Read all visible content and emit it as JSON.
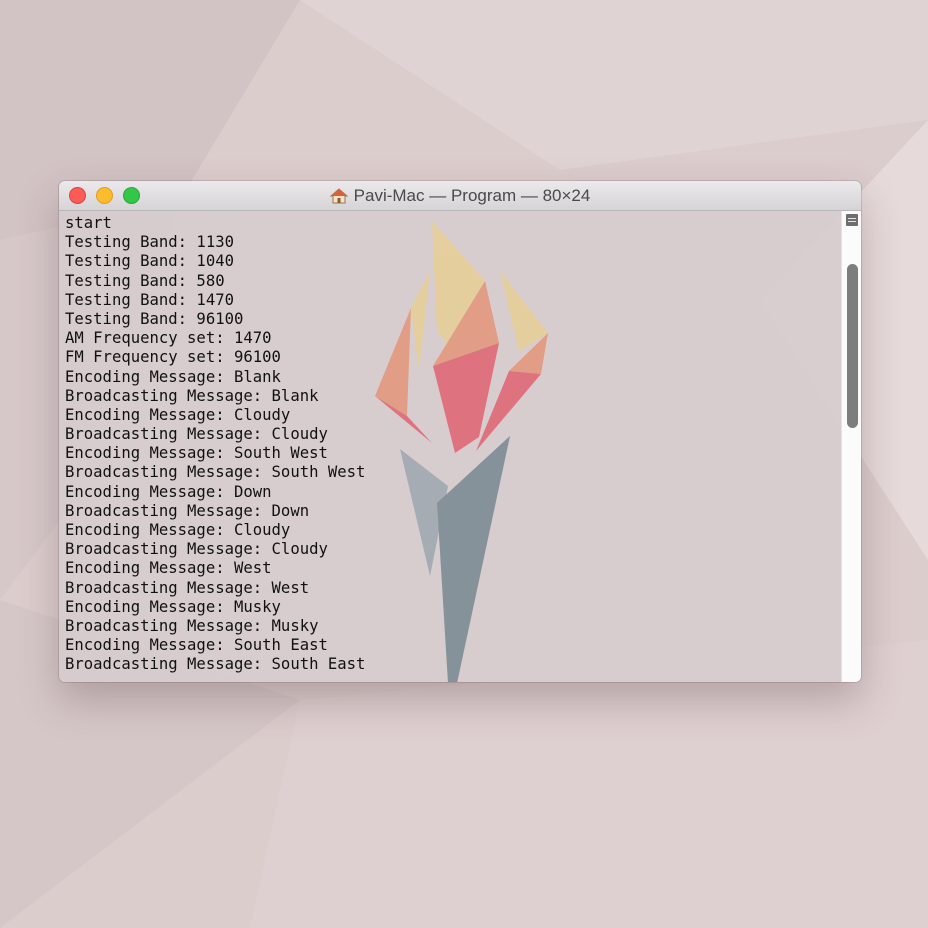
{
  "window": {
    "title": "Pavi-Mac — Program — 80×24",
    "title_icon": "home-icon"
  },
  "traffic_lights": {
    "close": "close-button",
    "minimize": "minimize-button",
    "maximize": "maximize-button"
  },
  "terminal": {
    "lines": [
      "start",
      "Testing Band: 1130",
      "Testing Band: 1040",
      "Testing Band: 580",
      "Testing Band: 1470",
      "Testing Band: 96100",
      "AM Frequency set: 1470",
      "FM Frequency set: 96100",
      "Encoding Message: Blank",
      "Broadcasting Message: Blank",
      "Encoding Message: Cloudy",
      "Broadcasting Message: Cloudy",
      "Encoding Message: South West",
      "Broadcasting Message: South West",
      "Encoding Message: Down",
      "Broadcasting Message: Down",
      "Encoding Message: Cloudy",
      "Broadcasting Message: Cloudy",
      "Encoding Message: West",
      "Broadcasting Message: West",
      "Encoding Message: Musky",
      "Broadcasting Message: Musky",
      "Encoding Message: South East",
      "Broadcasting Message: South East"
    ]
  },
  "colors": {
    "close": "#fc5b57",
    "minimize": "#fdbc2e",
    "maximize": "#33c748",
    "flame_yellow": "#e7cf9b",
    "flame_orange": "#e29a7f",
    "flame_red": "#e06b79",
    "torch_slate": "#7f8d95"
  }
}
